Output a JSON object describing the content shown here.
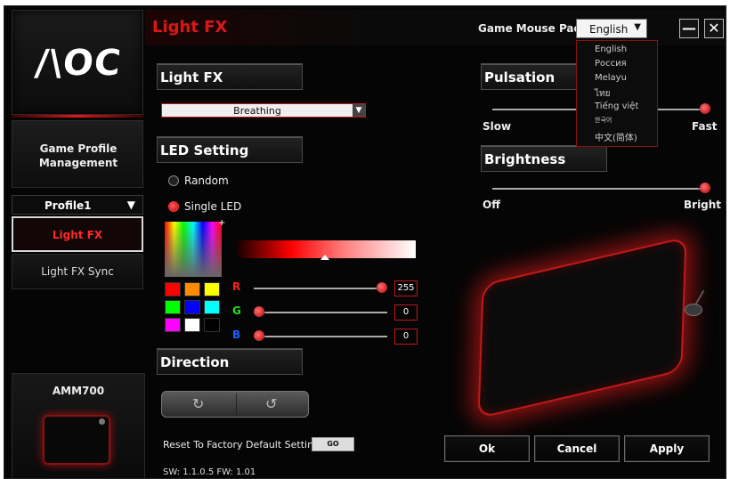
{
  "brand": {
    "logo_text": "/\\OC"
  },
  "sidebar": {
    "profile_management": [
      "Game Profile",
      "Management"
    ],
    "profile_select": {
      "value": "Profile1",
      "arrow": "▼"
    },
    "items": [
      {
        "label": "Light FX",
        "active": true
      },
      {
        "label": "Light FX Sync",
        "active": false
      }
    ],
    "device_name": "AMM700"
  },
  "header": {
    "title": "Light FX",
    "device_label": "Game Mouse Pad",
    "language": "English",
    "minimize": "—",
    "close": "✕"
  },
  "language_menu": [
    "English",
    "Россия",
    "Melayu",
    "ไทย",
    "Tiếng việt",
    "한국어",
    "中文(简体)"
  ],
  "lightfx": {
    "section_title": "Light FX",
    "effect": "Breathing"
  },
  "led_setting": {
    "section_title": "LED Setting",
    "options": [
      {
        "label": "Random",
        "selected": false
      },
      {
        "label": "Single LED",
        "selected": true
      }
    ],
    "swatches": [
      "#ff0000",
      "#ff8c00",
      "#ffff00",
      "#00ff00",
      "#0000ff",
      "#00ffff",
      "#ff00ff",
      "#ffffff",
      "#000000"
    ],
    "rgb": [
      {
        "label": "R",
        "value": "255",
        "fraction": 1.0,
        "color": "#ff2020"
      },
      {
        "label": "G",
        "value": "0",
        "fraction": 0.0,
        "color": "#20e020"
      },
      {
        "label": "B",
        "value": "0",
        "fraction": 0.0,
        "color": "#2060ff"
      }
    ]
  },
  "direction": {
    "section_title": "Direction",
    "cw_icon": "↻",
    "ccw_icon": "↺"
  },
  "pulsation": {
    "section_title": "Pulsation",
    "min_label": "Slow",
    "max_label": "Fast",
    "fraction": 1.0
  },
  "brightness": {
    "section_title": "Brightness",
    "min_label": "Off",
    "max_label": "Bright",
    "fraction": 1.0
  },
  "footer": {
    "reset_label": "Reset To Factory Default Settings",
    "go": "GO",
    "version": "SW: 1.1.0.5   FW: 1.01"
  },
  "actions": {
    "ok": "Ok",
    "cancel": "Cancel",
    "apply": "Apply"
  },
  "colors": {
    "accent": "#d31a1a",
    "background": "#050505"
  }
}
